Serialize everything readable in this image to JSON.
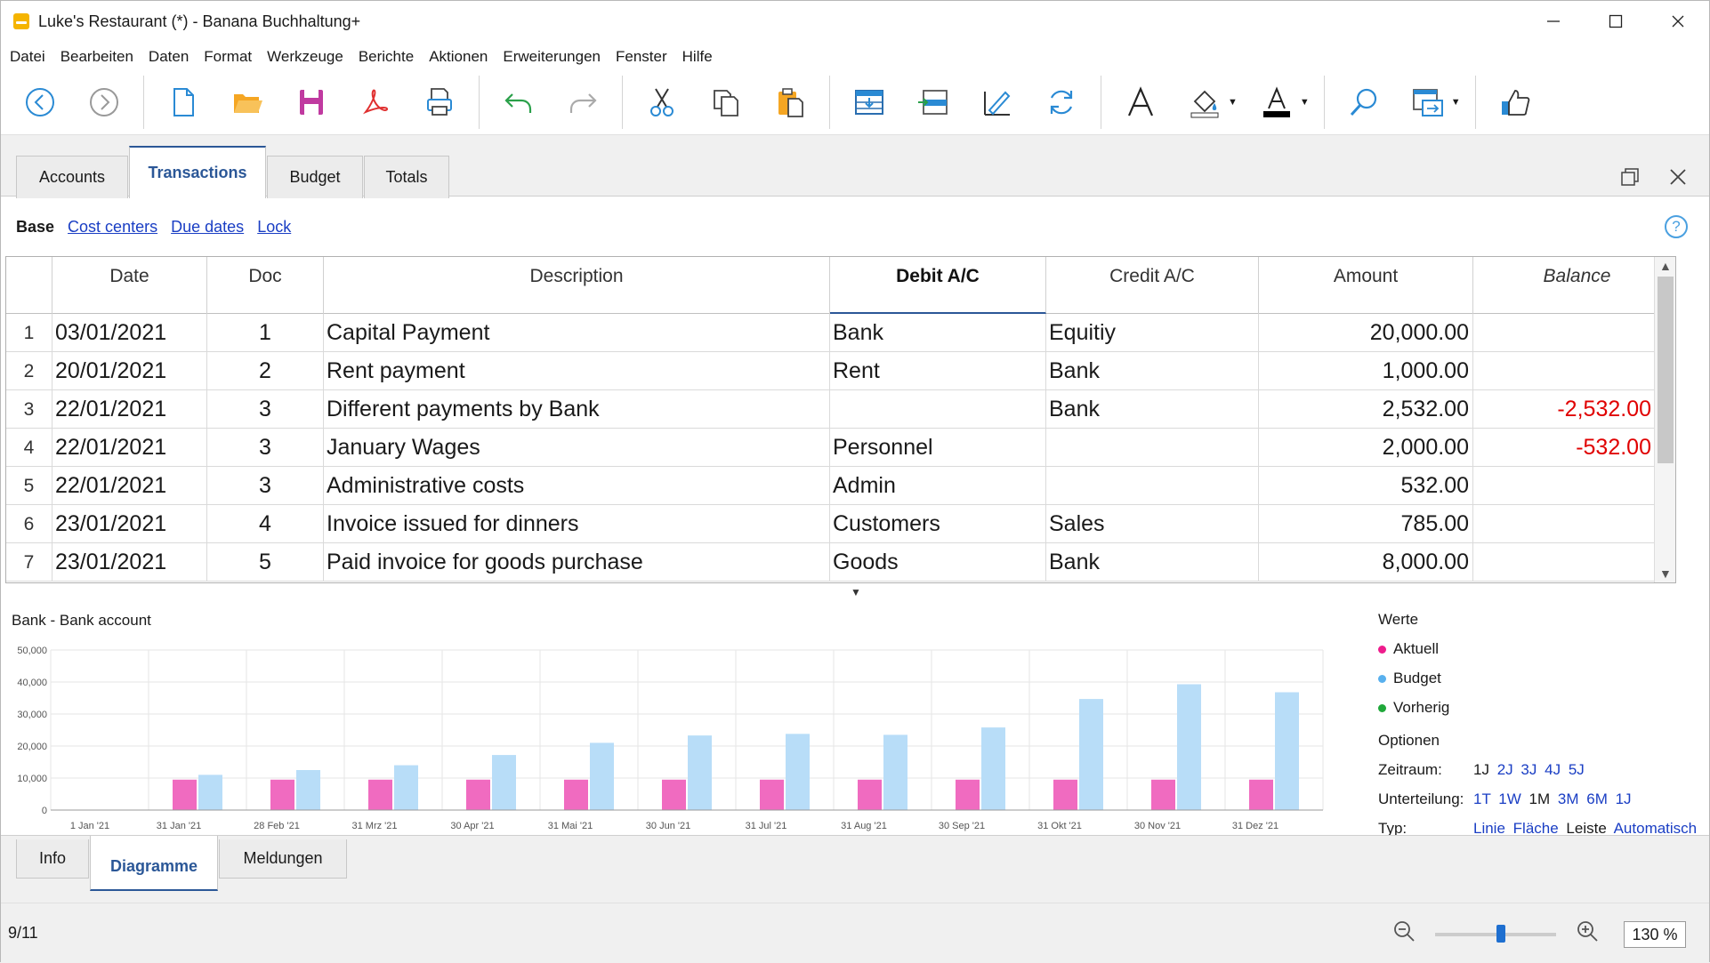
{
  "window": {
    "title": "Luke's Restaurant (*) - Banana Buchhaltung+",
    "controls": [
      "minimize",
      "maximize",
      "close"
    ]
  },
  "menu": [
    "Datei",
    "Bearbeiten",
    "Daten",
    "Format",
    "Werkzeuge",
    "Berichte",
    "Aktionen",
    "Erweiterungen",
    "Fenster",
    "Hilfe"
  ],
  "toolbar_icons": [
    "back-icon",
    "forward-icon",
    "new-document-icon",
    "open-folder-icon",
    "save-icon",
    "pdf-icon",
    "print-icon",
    "undo-icon",
    "redo-icon",
    "cut-icon",
    "copy-icon",
    "paste-icon",
    "insert-rows-icon",
    "move-rows-icon",
    "edit-icon",
    "refresh-icon",
    "font-icon",
    "fill-color-icon",
    "text-color-icon",
    "search-icon",
    "window-icon",
    "thumbs-up-icon"
  ],
  "tabs": [
    "Accounts",
    "Transactions",
    "Budget",
    "Totals"
  ],
  "active_tab": "Transactions",
  "sublinks": {
    "base": "Base",
    "links": [
      "Cost centers",
      "Due dates",
      "Lock"
    ]
  },
  "table": {
    "columns": [
      "Date",
      "Doc",
      "Description",
      "Debit A/C",
      "Credit A/C",
      "Amount",
      "Balance"
    ],
    "rows": [
      {
        "n": "1",
        "date": "03/01/2021",
        "doc": "1",
        "desc": "Capital Payment",
        "debit": "Bank",
        "credit": "Equitiy",
        "amount": "20,000.00",
        "balance": ""
      },
      {
        "n": "2",
        "date": "20/01/2021",
        "doc": "2",
        "desc": "Rent payment",
        "debit": "Rent",
        "credit": "Bank",
        "amount": "1,000.00",
        "balance": ""
      },
      {
        "n": "3",
        "date": "22/01/2021",
        "doc": "3",
        "desc": "Different payments by Bank",
        "debit": "",
        "credit": "Bank",
        "amount": "2,532.00",
        "balance": "-2,532.00"
      },
      {
        "n": "4",
        "date": "22/01/2021",
        "doc": "3",
        "desc": "January Wages",
        "debit": "Personnel",
        "credit": "",
        "amount": "2,000.00",
        "balance": "-532.00"
      },
      {
        "n": "5",
        "date": "22/01/2021",
        "doc": "3",
        "desc": "Administrative costs",
        "debit": "Admin",
        "credit": "",
        "amount": "532.00",
        "balance": ""
      },
      {
        "n": "6",
        "date": "23/01/2021",
        "doc": "4",
        "desc": "Invoice issued for dinners",
        "debit": "Customers",
        "credit": "Sales",
        "amount": "785.00",
        "balance": ""
      },
      {
        "n": "7",
        "date": "23/01/2021",
        "doc": "5",
        "desc": "Paid invoice for goods purchase",
        "debit": "Goods",
        "credit": "Bank",
        "amount": "8,000.00",
        "balance": ""
      }
    ]
  },
  "chart_title": "Bank - Bank account",
  "chart_data": {
    "type": "bar",
    "title": "Bank - Bank account",
    "categories": [
      "1 Jan '21",
      "31 Jan '21",
      "28 Feb '21",
      "31 Mrz '21",
      "30 Apr '21",
      "31 Mai '21",
      "30 Jun '21",
      "31 Jul '21",
      "31 Aug '21",
      "30 Sep '21",
      "31 Okt '21",
      "30 Nov '21",
      "31 Dez '21"
    ],
    "yticks": [
      "50,000",
      "40,000",
      "30,000",
      "20,000",
      "10,000",
      "0"
    ],
    "ylim": [
      0,
      50000
    ],
    "grid": true,
    "legend": "right",
    "series": [
      {
        "name": "Aktuell",
        "color": "#f06bc0",
        "values": [
          0,
          9500,
          9500,
          9500,
          9500,
          9500,
          9500,
          9500,
          9500,
          9500,
          9500,
          9500,
          9500
        ]
      },
      {
        "name": "Budget",
        "color": "#b8ddf8",
        "values": [
          0,
          11000,
          12500,
          14000,
          17200,
          21000,
          23300,
          23800,
          23500,
          25800,
          34700,
          39300,
          36800
        ]
      },
      {
        "name": "Vorherig",
        "color": "#1fa83a",
        "values": []
      }
    ]
  },
  "legend": {
    "title": "Werte",
    "items": [
      {
        "label": "Aktuell",
        "color": "#ee1c8c"
      },
      {
        "label": "Budget",
        "color": "#58b0ee"
      },
      {
        "label": "Vorherig",
        "color": "#1fa83a"
      }
    ],
    "options_title": "Optionen",
    "zeitraum_label": "Zeitraum:",
    "zeitraum": [
      {
        "label": "1J",
        "active": true
      },
      {
        "label": "2J",
        "active": false
      },
      {
        "label": "3J",
        "active": false
      },
      {
        "label": "4J",
        "active": false
      },
      {
        "label": "5J",
        "active": false
      }
    ],
    "unterteilung_label": "Unterteilung:",
    "unterteilung": [
      {
        "label": "1T",
        "active": false
      },
      {
        "label": "1W",
        "active": false
      },
      {
        "label": "1M",
        "active": true
      },
      {
        "label": "3M",
        "active": false
      },
      {
        "label": "6M",
        "active": false
      },
      {
        "label": "1J",
        "active": false
      }
    ],
    "typ_label": "Typ:",
    "typ": [
      {
        "label": "Linie",
        "active": false
      },
      {
        "label": "Fläche",
        "active": false
      },
      {
        "label": "Leiste",
        "active": true
      },
      {
        "label": "Automatisch",
        "active": false
      }
    ]
  },
  "bottom_tabs": [
    "Info",
    "Diagramme",
    "Meldungen"
  ],
  "active_bottom_tab": "Diagramme",
  "status": {
    "position": "9/11",
    "zoom": "130 %",
    "zoom_slider_level": 0.55
  }
}
